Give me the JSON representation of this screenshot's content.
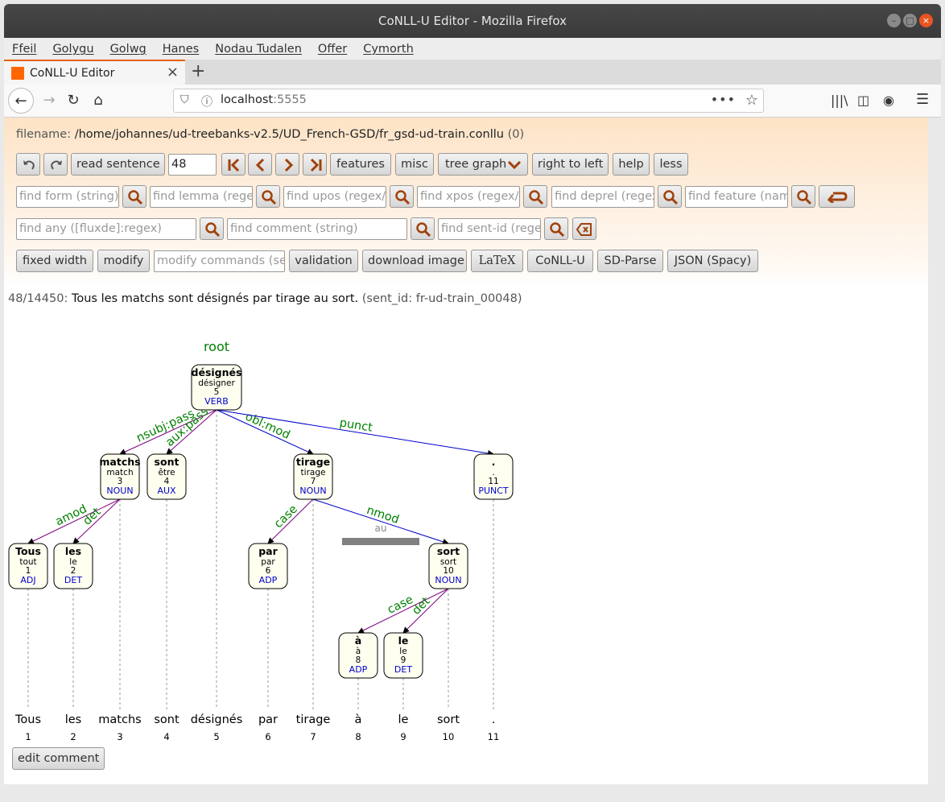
{
  "window": {
    "title": "CoNLL-U Editor - Mozilla Firefox"
  },
  "menu": [
    "Ffeil",
    "Golygu",
    "Golwg",
    "Hanes",
    "Nodau Tudalen",
    "Offer",
    "Cymorth"
  ],
  "tab": {
    "label": "CoNLL-U Editor"
  },
  "url": {
    "host": "localhost",
    "port": ":5555"
  },
  "file": {
    "label": "filename:",
    "path": "/home/johannes/ud-treebanks-v2.5/UD_French-GSD/fr_gsd-ud-train.conllu",
    "count": "(0)"
  },
  "toolbar": {
    "read_sentence": "read sentence",
    "sentence_number": "48",
    "features": "features",
    "misc": "misc",
    "tree_graph": "tree graph",
    "right_to_left": "right to left",
    "help": "help",
    "less": "less",
    "fixed_width": "fixed width",
    "modify": "modify",
    "modify_placeholder": "modify commands (see",
    "validation": "validation",
    "download_image": "download image",
    "latex": "LaTeX",
    "conllu": "CoNLL-U",
    "sdparse": "SD-Parse",
    "json": "JSON (Spacy)"
  },
  "search": {
    "form": "find form (string)",
    "lemma": "find lemma (regex",
    "upos": "find upos (regex/.",
    "xpos": "find xpos (regex/.",
    "deprel": "find deprel (regex",
    "feature": "find feature (name",
    "any": "find any ([fluxde]:regex)",
    "comment": "find comment (string)",
    "sentid": "find sent-id (regex"
  },
  "sentence": {
    "position": "48/14450",
    "text": "Tous les matchs sont désignés par tirage au sort.",
    "sent_id": "(sent_id: fr-ud-train_00048)"
  },
  "tree": {
    "root_label": "root",
    "tokens": [
      {
        "id": "1",
        "form": "Tous",
        "lemma": "tout",
        "upos": "ADJ"
      },
      {
        "id": "2",
        "form": "les",
        "lemma": "le",
        "upos": "DET"
      },
      {
        "id": "3",
        "form": "matchs",
        "lemma": "match",
        "upos": "NOUN"
      },
      {
        "id": "4",
        "form": "sont",
        "lemma": "être",
        "upos": "AUX"
      },
      {
        "id": "5",
        "form": "désignés",
        "lemma": "désigner",
        "upos": "VERB"
      },
      {
        "id": "6",
        "form": "par",
        "lemma": "par",
        "upos": "ADP"
      },
      {
        "id": "7",
        "form": "tirage",
        "lemma": "tirage",
        "upos": "NOUN"
      },
      {
        "id": "8",
        "form": "à",
        "lemma": "à",
        "upos": "ADP"
      },
      {
        "id": "9",
        "form": "le",
        "lemma": "le",
        "upos": "DET"
      },
      {
        "id": "10",
        "form": "sort",
        "lemma": "sort",
        "upos": "NOUN"
      },
      {
        "id": "11",
        "form": ".",
        "lemma": ".",
        "upos": "PUNCT"
      }
    ],
    "edges": [
      {
        "head": "5",
        "dep": "3",
        "label": "nsubj:pass"
      },
      {
        "head": "5",
        "dep": "4",
        "label": "aux:pass"
      },
      {
        "head": "5",
        "dep": "7",
        "label": "obl:mod"
      },
      {
        "head": "5",
        "dep": "11",
        "label": "punct"
      },
      {
        "head": "3",
        "dep": "1",
        "label": "amod"
      },
      {
        "head": "3",
        "dep": "2",
        "label": "det"
      },
      {
        "head": "7",
        "dep": "6",
        "label": "case"
      },
      {
        "head": "7",
        "dep": "10",
        "label": "nmod"
      },
      {
        "head": "10",
        "dep": "8",
        "label": "case"
      },
      {
        "head": "10",
        "dep": "9",
        "label": "det"
      }
    ],
    "mwt": "au",
    "colors": {
      "deprel": "#008000",
      "upos": "#0000cc",
      "node_fill": "#fffff0",
      "purple_edge": "#800080",
      "blue_edge": "#0000cc"
    }
  },
  "edit_comment": "edit comment"
}
